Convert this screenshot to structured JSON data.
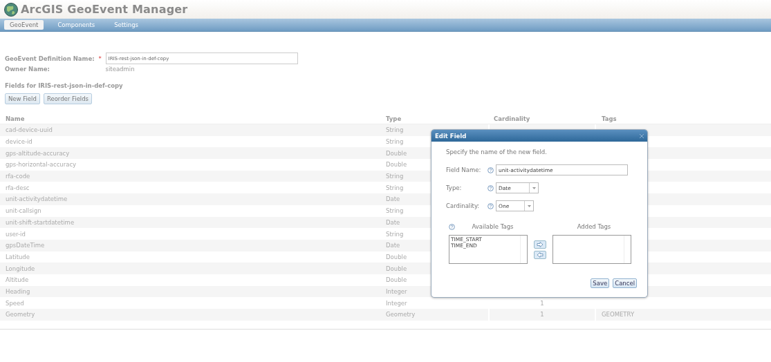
{
  "app": {
    "title": "ArcGIS GeoEvent Manager"
  },
  "tabs": [
    {
      "label": "GeoEvent",
      "selected": true
    },
    {
      "label": "Components",
      "selected": false
    },
    {
      "label": "Settings",
      "selected": false
    }
  ],
  "form": {
    "definition_label": "GeoEvent Definition Name:",
    "required_mark": "*",
    "definition_value": "IRIS-rest-json-in-def-copy",
    "owner_label": "Owner Name:",
    "owner_value": "siteadmin"
  },
  "fields_heading": "Fields for IRIS-rest-json-in-def-copy",
  "buttons": [
    "New Field",
    "Reorder Fields"
  ],
  "table": {
    "columns": [
      "Name",
      "Type",
      "Cardinality",
      "Tags"
    ],
    "rows": [
      {
        "name": "cad-device-uuid",
        "type": "String"
      },
      {
        "name": "device-id",
        "type": "String"
      },
      {
        "name": "gps-altitude-accuracy",
        "type": "Double"
      },
      {
        "name": "gps-horizontal-accuracy",
        "type": "Double"
      },
      {
        "name": "rfa-code",
        "type": "String"
      },
      {
        "name": "rfa-desc",
        "type": "String"
      },
      {
        "name": "unit-activitydatetime",
        "type": "Date"
      },
      {
        "name": "unit-callsign",
        "type": "String"
      },
      {
        "name": "unit-shift-startdatetime",
        "type": "Date"
      },
      {
        "name": "user-id",
        "type": "String"
      },
      {
        "name": "gpsDateTime",
        "type": "Date"
      },
      {
        "name": "Latitude",
        "type": "Double"
      },
      {
        "name": "Longitude",
        "type": "Double"
      },
      {
        "name": "Altitude",
        "type": "Double"
      },
      {
        "name": "Heading",
        "type": "Integer"
      },
      {
        "name": "Speed",
        "type": "Integer",
        "cardinality": "1"
      },
      {
        "name": "Geometry",
        "type": "Geometry",
        "cardinality": "1",
        "tags": "GEOMETRY"
      }
    ]
  },
  "dialog": {
    "title": "Edit Field",
    "description": "Specify the name of the new field.",
    "fields": [
      {
        "label": "Field Name:",
        "kind": "text",
        "value": "unit-activitydatetime"
      },
      {
        "label": "Type:",
        "kind": "select",
        "value": "Date"
      },
      {
        "label": "Cardinality:",
        "kind": "select",
        "value": "One"
      }
    ],
    "available_tags_label": "Available Tags",
    "added_tags_label": "Added Tags",
    "available_tags": [
      "TIME_START",
      "TIME_END"
    ],
    "buttons": [
      "Save",
      "Cancel"
    ]
  }
}
